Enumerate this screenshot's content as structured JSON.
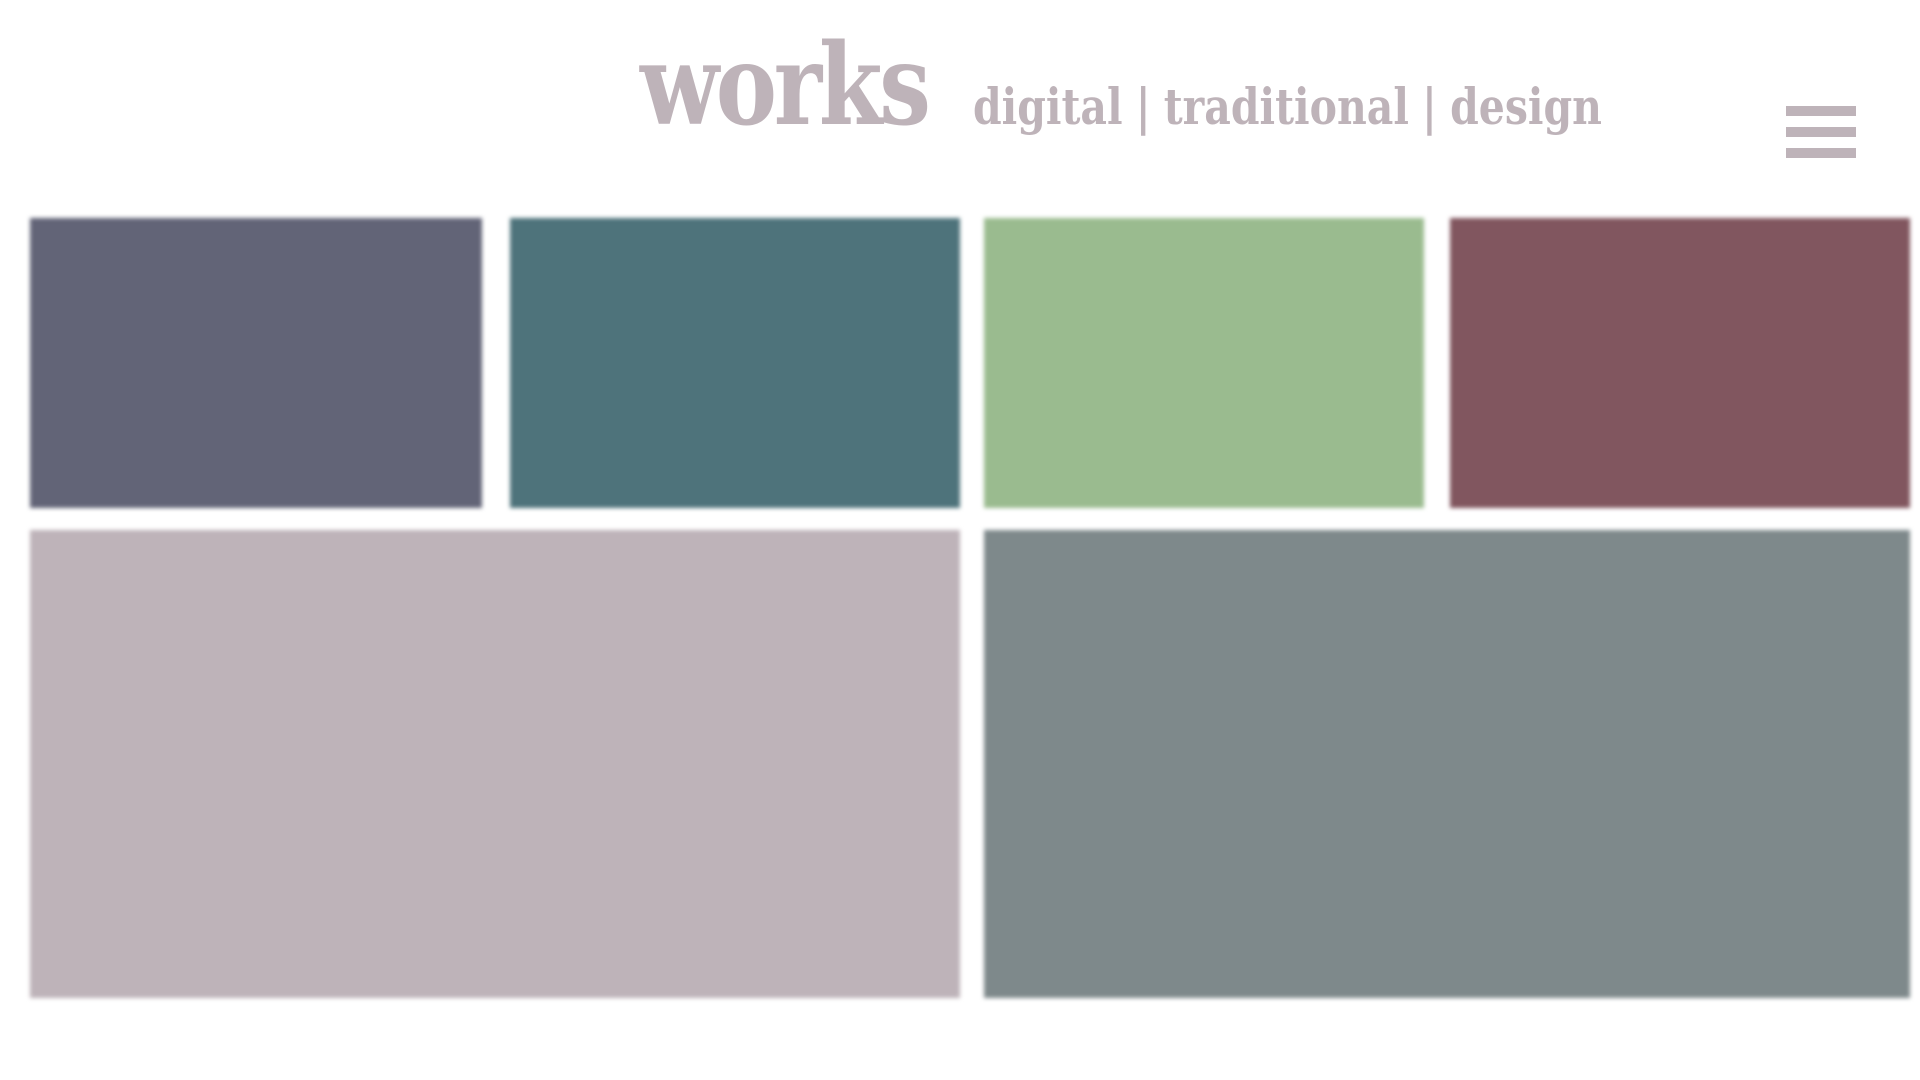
{
  "header": {
    "title": "works",
    "nav": [
      {
        "label": "digital"
      },
      {
        "label": "traditional"
      },
      {
        "label": "design"
      }
    ],
    "separator": "|",
    "menu_icon": "hamburger-menu-icon"
  },
  "colors": {
    "accent": "#beb3b9",
    "background": "#ffffff"
  },
  "gallery": {
    "tiles": [
      {
        "color": "#626477"
      },
      {
        "color": "#4e737b"
      },
      {
        "color": "#9abb8f"
      },
      {
        "color": "#81565f"
      },
      {
        "color": "#beb3b9"
      },
      {
        "color": "#7e898b"
      }
    ]
  }
}
